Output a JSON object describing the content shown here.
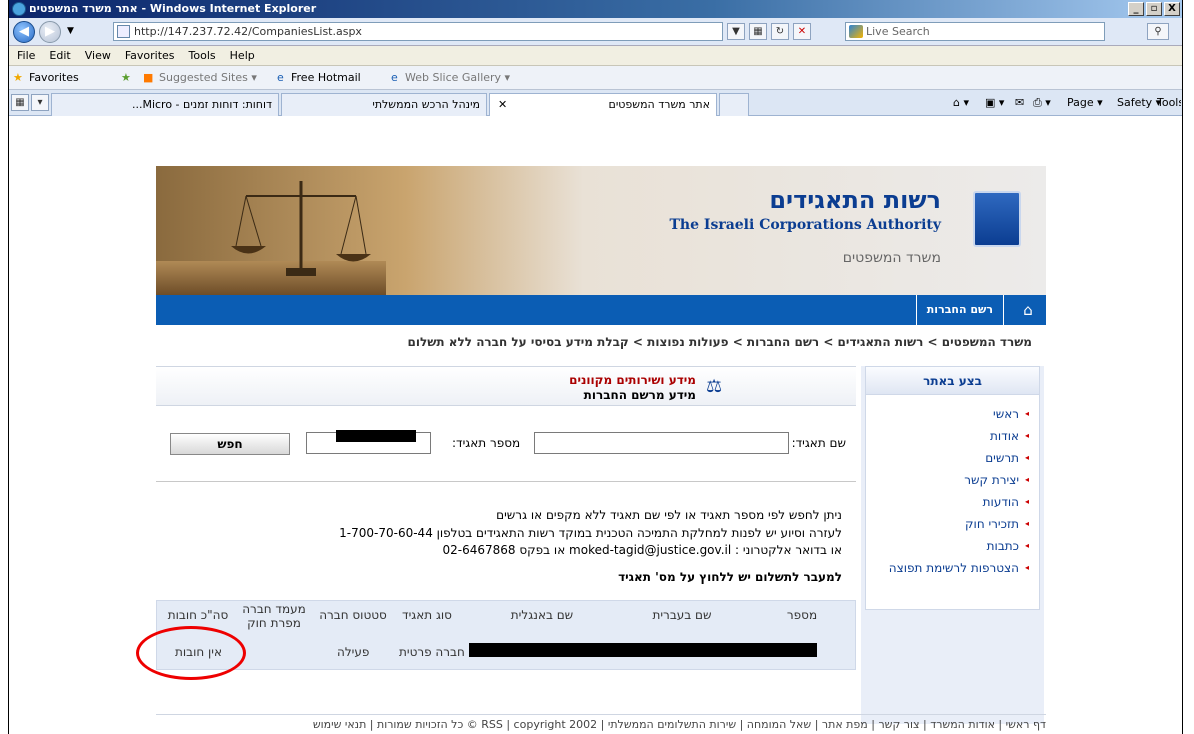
{
  "window": {
    "title": "אתר משרד המשפטים - Windows Internet Explorer",
    "minimize": "_",
    "maximize": "▫",
    "close": "X"
  },
  "address": {
    "url": "http://147.237.72.42/CompaniesList.aspx",
    "search_placeholder": "Live Search"
  },
  "menu": [
    "File",
    "Edit",
    "View",
    "Favorites",
    "Tools",
    "Help"
  ],
  "favorites": {
    "label": "Favorites",
    "items": [
      "Suggested Sites ▾",
      "Free Hotmail",
      "Web Slice Gallery ▾"
    ]
  },
  "tabs": [
    {
      "label": "דוחות: דוחות זמנים - Micro..."
    },
    {
      "label": "מינהל הרכש הממשלתי"
    },
    {
      "label": "אתר משרד המשפטים"
    }
  ],
  "toolbar": [
    "Page ▾",
    "Safety ▾",
    "Tools ▾"
  ],
  "banner": {
    "title_he": "רשות התאגידים",
    "title_en_1": "The Israeli Corporations Authority",
    "ministry": "משרד המשפטים"
  },
  "nav": {
    "registry": "רשם החברות"
  },
  "breadcrumb": "משרד המשפטים > רשות התאגידים > רשם החברות > פעולות נפוצות > קבלת מידע בסיסי על חברה ללא תשלום",
  "sidebar": {
    "title": "בצע באתר",
    "items": [
      "ראשי",
      "אודות",
      "תרשים",
      "יצירת קשר",
      "הודעות",
      "תזכירי חוק",
      "כתבות",
      "הצטרפות לרשימת תפוצה"
    ]
  },
  "panel": {
    "title": "מידע ושירותים מקוונים",
    "subtitle": "מידע מרשם החברות"
  },
  "form": {
    "name_label": "שם תאגיד:",
    "number_label": "מספר תאגיד:",
    "search_button": "חפש"
  },
  "info": {
    "line1": "ניתן לחפש לפי מספר תאגיד או לפי שם תאגיד ללא מקפים או גרשים",
    "line2": "לעזרה וסיוע יש לפנות למחלקת התמיכה הטכנית במוקד רשות התאגידים בטלפון 1-700-70-60-44",
    "line3": "או בדואר אלקטרוני : moked-tagid@justice.gov.il או בפקס 02-6467868",
    "line4": "למעבר לתשלום יש ללחוץ על מס' תאגיד"
  },
  "table": {
    "headers": [
      "מספר",
      "שם בעברית",
      "שם באנגלית",
      "סוג תאגיד",
      "סטטוס חברה",
      "מעמד חברה מפרת חוק",
      "סה\"כ חובות"
    ],
    "row": {
      "type": "חברה פרטית",
      "status": "פעילה",
      "debts": "אין חובות"
    }
  },
  "footer": "דף ראשי | אודות המשרד | צור קשר | מפת אתר | שאל המומחה | שירות התשלומים הממשלתי | RSS | copyright 2002 © כל הזכויות שמורות | תנאי שימוש"
}
